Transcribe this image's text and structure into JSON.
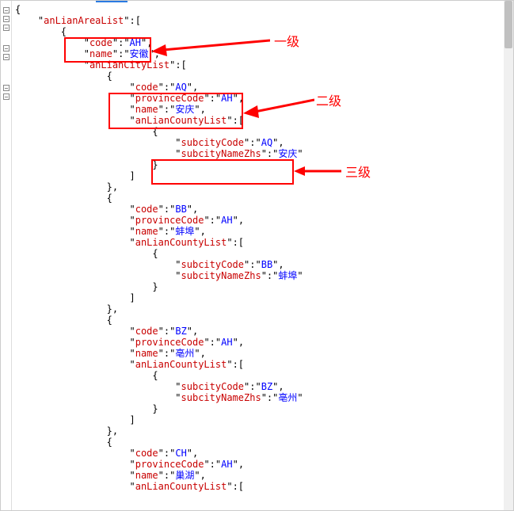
{
  "annotations": {
    "level1": "一级",
    "level2": "二级",
    "level3": "三级"
  },
  "json_tree": {
    "root_key": "anLianAreaList",
    "areas": [
      {
        "code_key": "code",
        "code_val": "AH",
        "name_key": "name",
        "name_val": "安徽",
        "city_list_key": "anLianCityList",
        "cities": [
          {
            "code_key": "code",
            "code_val": "AQ",
            "prov_key": "provinceCode",
            "prov_val": "AH",
            "name_key": "name",
            "name_val": "安庆",
            "county_list_key": "anLianCountyList",
            "counties": [
              {
                "sc_key": "subcityCode",
                "sc_val": "AQ",
                "sn_key": "subcityNameZhs",
                "sn_val": "安庆"
              }
            ]
          },
          {
            "code_key": "code",
            "code_val": "BB",
            "prov_key": "provinceCode",
            "prov_val": "AH",
            "name_key": "name",
            "name_val": "蚌埠",
            "county_list_key": "anLianCountyList",
            "counties": [
              {
                "sc_key": "subcityCode",
                "sc_val": "BB",
                "sn_key": "subcityNameZhs",
                "sn_val": "蚌埠"
              }
            ]
          },
          {
            "code_key": "code",
            "code_val": "BZ",
            "prov_key": "provinceCode",
            "prov_val": "AH",
            "name_key": "name",
            "name_val": "亳州",
            "county_list_key": "anLianCountyList",
            "counties": [
              {
                "sc_key": "subcityCode",
                "sc_val": "BZ",
                "sn_key": "subcityNameZhs",
                "sn_val": "亳州"
              }
            ]
          },
          {
            "code_key": "code",
            "code_val": "CH",
            "prov_key": "provinceCode",
            "prov_val": "AH",
            "name_key": "name",
            "name_val": "巢湖",
            "county_list_key": "anLianCountyList",
            "counties": []
          }
        ]
      }
    ]
  }
}
